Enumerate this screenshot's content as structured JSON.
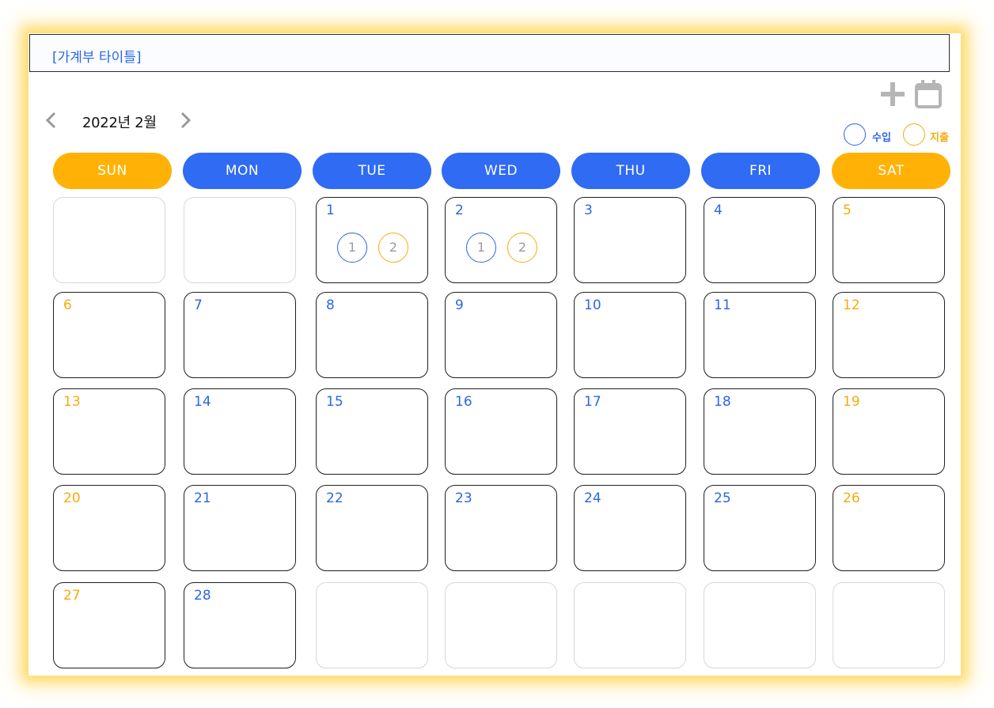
{
  "app": {
    "title": "[가계부 타이틀]",
    "month_label": "2022년 2월"
  },
  "toolbar": {
    "add_icon": "plus-icon",
    "calendar_icon": "calendar-icon"
  },
  "nav": {
    "prev_icon": "chevron-left-icon",
    "next_icon": "chevron-right-icon"
  },
  "legend": {
    "income_label": "수입",
    "expense_label": "지출"
  },
  "colors": {
    "blue": "#2a66e8",
    "orange": "#f7ab0c",
    "header_blue": "#2f6bf3",
    "header_orange": "#ffb205"
  },
  "weekdays": [
    "SUN",
    "MON",
    "TUE",
    "WED",
    "THU",
    "FRI",
    "SAT"
  ],
  "days": [
    {
      "day": "",
      "entries": []
    },
    {
      "day": "",
      "entries": []
    },
    {
      "day": "1",
      "entries": [
        {
          "type": "income",
          "count": "1"
        },
        {
          "type": "expense",
          "count": "2"
        }
      ]
    },
    {
      "day": "2",
      "entries": [
        {
          "type": "income",
          "count": "1"
        },
        {
          "type": "expense",
          "count": "2"
        }
      ]
    },
    {
      "day": "3",
      "entries": []
    },
    {
      "day": "4",
      "entries": []
    },
    {
      "day": "5",
      "entries": []
    },
    {
      "day": "6",
      "entries": []
    },
    {
      "day": "7",
      "entries": []
    },
    {
      "day": "8",
      "entries": []
    },
    {
      "day": "9",
      "entries": []
    },
    {
      "day": "10",
      "entries": []
    },
    {
      "day": "11",
      "entries": []
    },
    {
      "day": "12",
      "entries": []
    },
    {
      "day": "13",
      "entries": []
    },
    {
      "day": "14",
      "entries": []
    },
    {
      "day": "15",
      "entries": []
    },
    {
      "day": "16",
      "entries": []
    },
    {
      "day": "17",
      "entries": []
    },
    {
      "day": "18",
      "entries": []
    },
    {
      "day": "19",
      "entries": []
    },
    {
      "day": "20",
      "entries": []
    },
    {
      "day": "21",
      "entries": []
    },
    {
      "day": "22",
      "entries": []
    },
    {
      "day": "23",
      "entries": []
    },
    {
      "day": "24",
      "entries": []
    },
    {
      "day": "25",
      "entries": []
    },
    {
      "day": "26",
      "entries": []
    },
    {
      "day": "27",
      "entries": []
    },
    {
      "day": "28",
      "entries": []
    },
    {
      "day": "",
      "entries": []
    },
    {
      "day": "",
      "entries": []
    },
    {
      "day": "",
      "entries": []
    },
    {
      "day": "",
      "entries": []
    },
    {
      "day": "",
      "entries": []
    }
  ]
}
